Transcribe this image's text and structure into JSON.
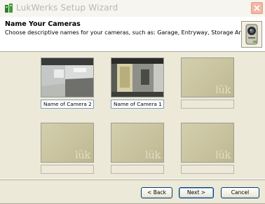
{
  "window": {
    "title": "LukWerks Setup Wizard",
    "close_icon": "close-icon"
  },
  "header": {
    "title": "Name Your Cameras",
    "subtitle": "Choose descriptive names for your cameras, such as:  Garage, Entryway, Storage Area",
    "icon": "camera-icon"
  },
  "cameras": [
    {
      "name": "Name of Camera 2",
      "has_image": true,
      "state": "active"
    },
    {
      "name": "Name of Camera 1",
      "has_image": true,
      "state": "active"
    },
    {
      "name": "",
      "has_image": false,
      "state": "disabled",
      "watermark": "lük"
    },
    {
      "name": "",
      "has_image": false,
      "state": "disabled",
      "watermark": "lük"
    },
    {
      "name": "",
      "has_image": false,
      "state": "disabled",
      "watermark": "lük"
    },
    {
      "name": "",
      "has_image": false,
      "state": "disabled",
      "watermark": "lük"
    }
  ],
  "buttons": {
    "back": "< Back",
    "next": "Next >",
    "cancel": "Cancel"
  },
  "colors": {
    "dialog_bg": "#ece9d8",
    "close_button": "#f2b8a6",
    "button_border": "#003c74"
  }
}
